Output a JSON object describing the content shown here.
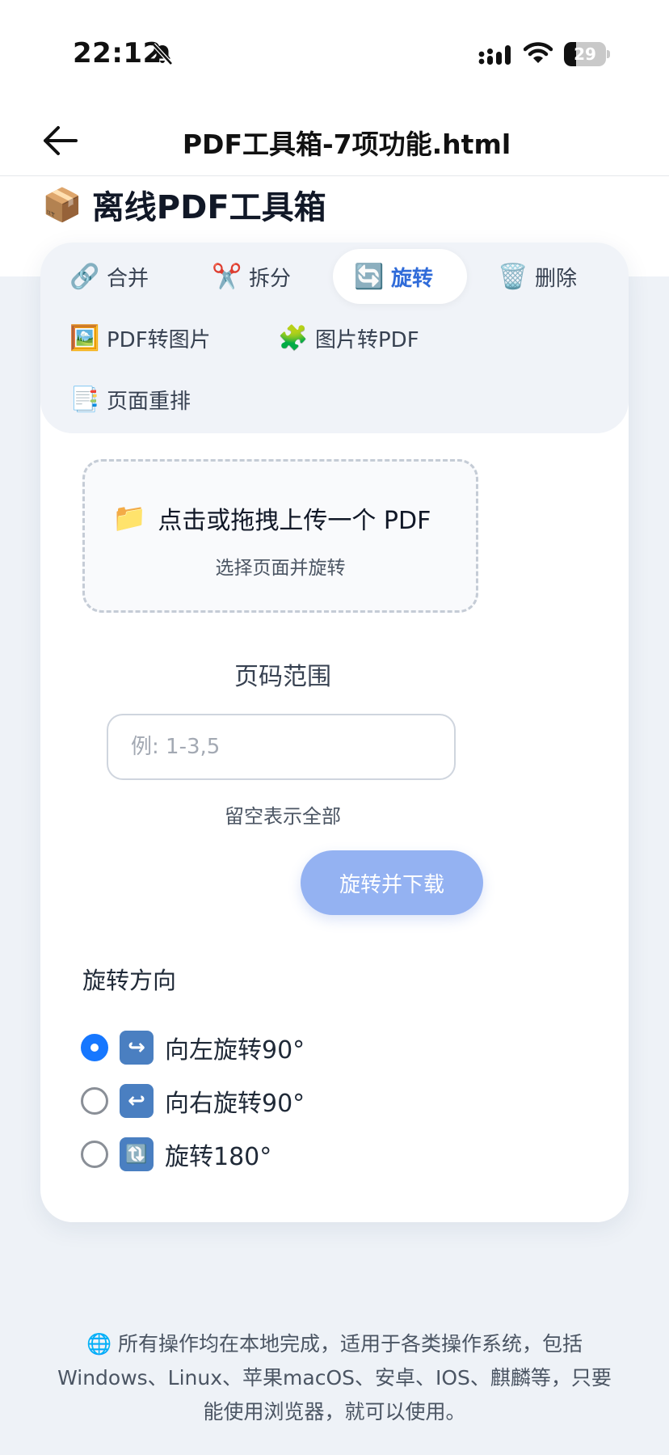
{
  "status_bar": {
    "time": "22:12",
    "battery_level": "29",
    "battery_fraction": 0.29,
    "icons": [
      "bell-slash-icon",
      "signal-icon",
      "wifi-icon",
      "battery-icon"
    ]
  },
  "nav": {
    "title": "PDF工具箱-7项功能.html",
    "back_icon": "arrow-left-icon"
  },
  "header": {
    "emoji": "📦",
    "title": "离线PDF工具箱"
  },
  "tabs": [
    {
      "icon": "🔗",
      "label": "合并"
    },
    {
      "icon": "✂️",
      "label": "拆分"
    },
    {
      "icon": "🔄",
      "label": "旋转",
      "active": true
    },
    {
      "icon": "🗑️",
      "label": "删除"
    },
    {
      "icon": "🖼️",
      "label": "PDF转图片"
    },
    {
      "icon": "🧩",
      "label": "图片转PDF"
    },
    {
      "icon": "📑",
      "label": "页面重排"
    }
  ],
  "upload": {
    "icon": "📁",
    "title": "点击或拖拽上传一个 PDF",
    "subtitle": "选择页面并旋转"
  },
  "page_range": {
    "label": "页码范围",
    "value": "",
    "placeholder": "例: 1-3,5",
    "hint": "留空表示全部"
  },
  "action_button": "旋转并下载",
  "rotation": {
    "label": "旋转方向",
    "options": [
      {
        "icon": "↪",
        "label": "向左旋转90°",
        "checked": true
      },
      {
        "icon": "↩",
        "label": "向右旋转90°",
        "checked": false
      },
      {
        "icon": "🔃",
        "label": "旋转180°",
        "checked": false
      }
    ]
  },
  "footer": {
    "icon": "🌐",
    "line1": "所有操作均在本地完成，适用于各类操作系统，包括",
    "line2": "Windows、Linux、苹果macOS、安卓、IOS、麒麟等，只要",
    "line3": "能使用浏览器，就可以使用。"
  },
  "colors": {
    "accent": "#2f6bd9",
    "radio_checked": "#1677ff",
    "button_disabled": "#94b2f2",
    "page_bg": "#eef2f7"
  }
}
